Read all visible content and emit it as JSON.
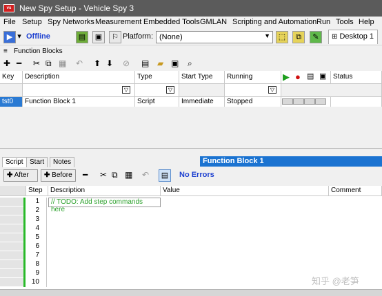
{
  "window": {
    "title": "New Spy Setup - Vehicle Spy 3"
  },
  "menu": [
    "File",
    "Setup",
    "Spy Networks",
    "Measurement",
    "Embedded Tools",
    "GMLAN",
    "Scripting and Automation",
    "Run",
    "Tools",
    "Help"
  ],
  "toolbar": {
    "status": "Offline",
    "platform_label": "Platform:",
    "platform_value": "(None)",
    "desktop_tab": "Desktop 1"
  },
  "function_blocks": {
    "header": "Function Blocks",
    "columns": [
      "Key",
      "Description",
      "Type",
      "Start Type",
      "Running",
      "Status"
    ],
    "rows": [
      {
        "key": "tst0",
        "description": "Function Block 1",
        "type": "Script",
        "start_type": "Immediate",
        "running": "Stopped",
        "status": ""
      }
    ]
  },
  "editor": {
    "tabs": [
      "Script",
      "Start",
      "Notes"
    ],
    "block_title": "Function Block 1",
    "after_label": "After",
    "before_label": "Before",
    "errors": "No Errors",
    "columns": [
      "Step",
      "Description",
      "Value",
      "Comment"
    ],
    "steps": [
      "1",
      "2",
      "3",
      "4",
      "5",
      "6",
      "7",
      "8",
      "9",
      "10"
    ],
    "todo": "// TODO: Add step commands here"
  },
  "watermark": "知乎 @老笋"
}
